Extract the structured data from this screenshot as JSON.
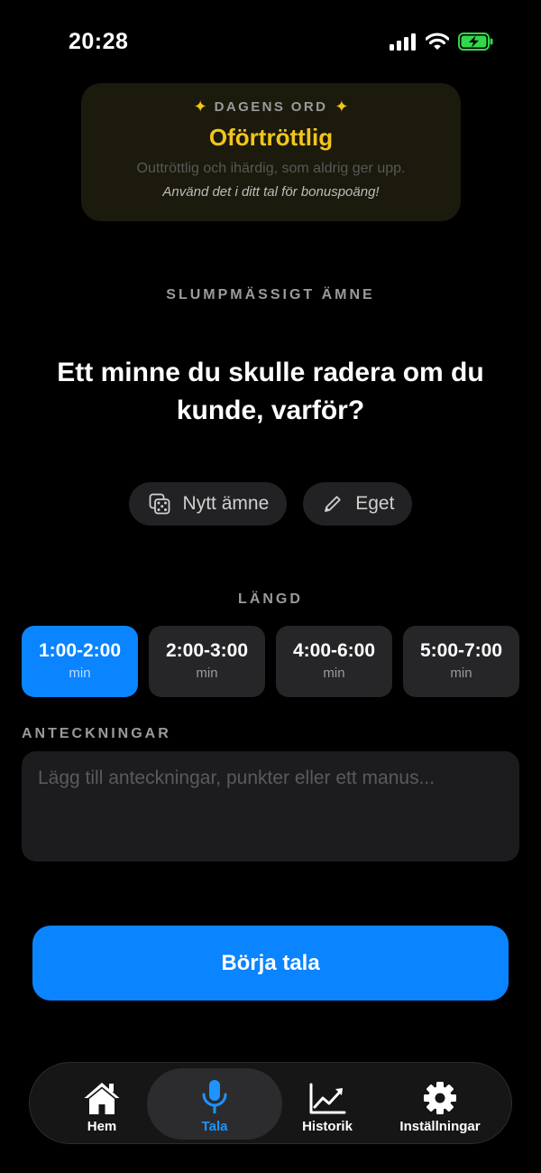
{
  "status": {
    "time": "20:28"
  },
  "word_of_day": {
    "label": "DAGENS ORD",
    "word": "Oförtröttlig",
    "definition": "Outtröttlig och ihärdig, som aldrig ger upp.",
    "hint": "Använd det i ditt tal för bonuspoäng!"
  },
  "topic": {
    "label": "SLUMPMÄSSIGT ÄMNE",
    "text": "Ett minne du skulle radera om du kunde, varför?",
    "new_label": "Nytt ämne",
    "custom_label": "Eget"
  },
  "length": {
    "label": "LÄNGD",
    "options": [
      {
        "range": "1:00-2:00",
        "unit": "min",
        "selected": true
      },
      {
        "range": "2:00-3:00",
        "unit": "min",
        "selected": false
      },
      {
        "range": "4:00-6:00",
        "unit": "min",
        "selected": false
      },
      {
        "range": "5:00-7:00",
        "unit": "min",
        "selected": false
      }
    ]
  },
  "notes": {
    "label": "ANTECKNINGAR",
    "value": "",
    "placeholder": "Lägg till anteckningar, punkter eller ett manus..."
  },
  "start_button": {
    "label": "Börja tala"
  },
  "tabbar": {
    "active": "Tala",
    "items": [
      {
        "label": "Hem",
        "icon": "house-icon"
      },
      {
        "label": "Tala",
        "icon": "microphone-icon"
      },
      {
        "label": "Historik",
        "icon": "chart-line-icon"
      },
      {
        "label": "Inställningar",
        "icon": "gear-icon"
      }
    ]
  },
  "colors": {
    "accent": "#0a84ff",
    "word_highlight": "#f2c51b",
    "battery_charging": "#32d74b"
  }
}
